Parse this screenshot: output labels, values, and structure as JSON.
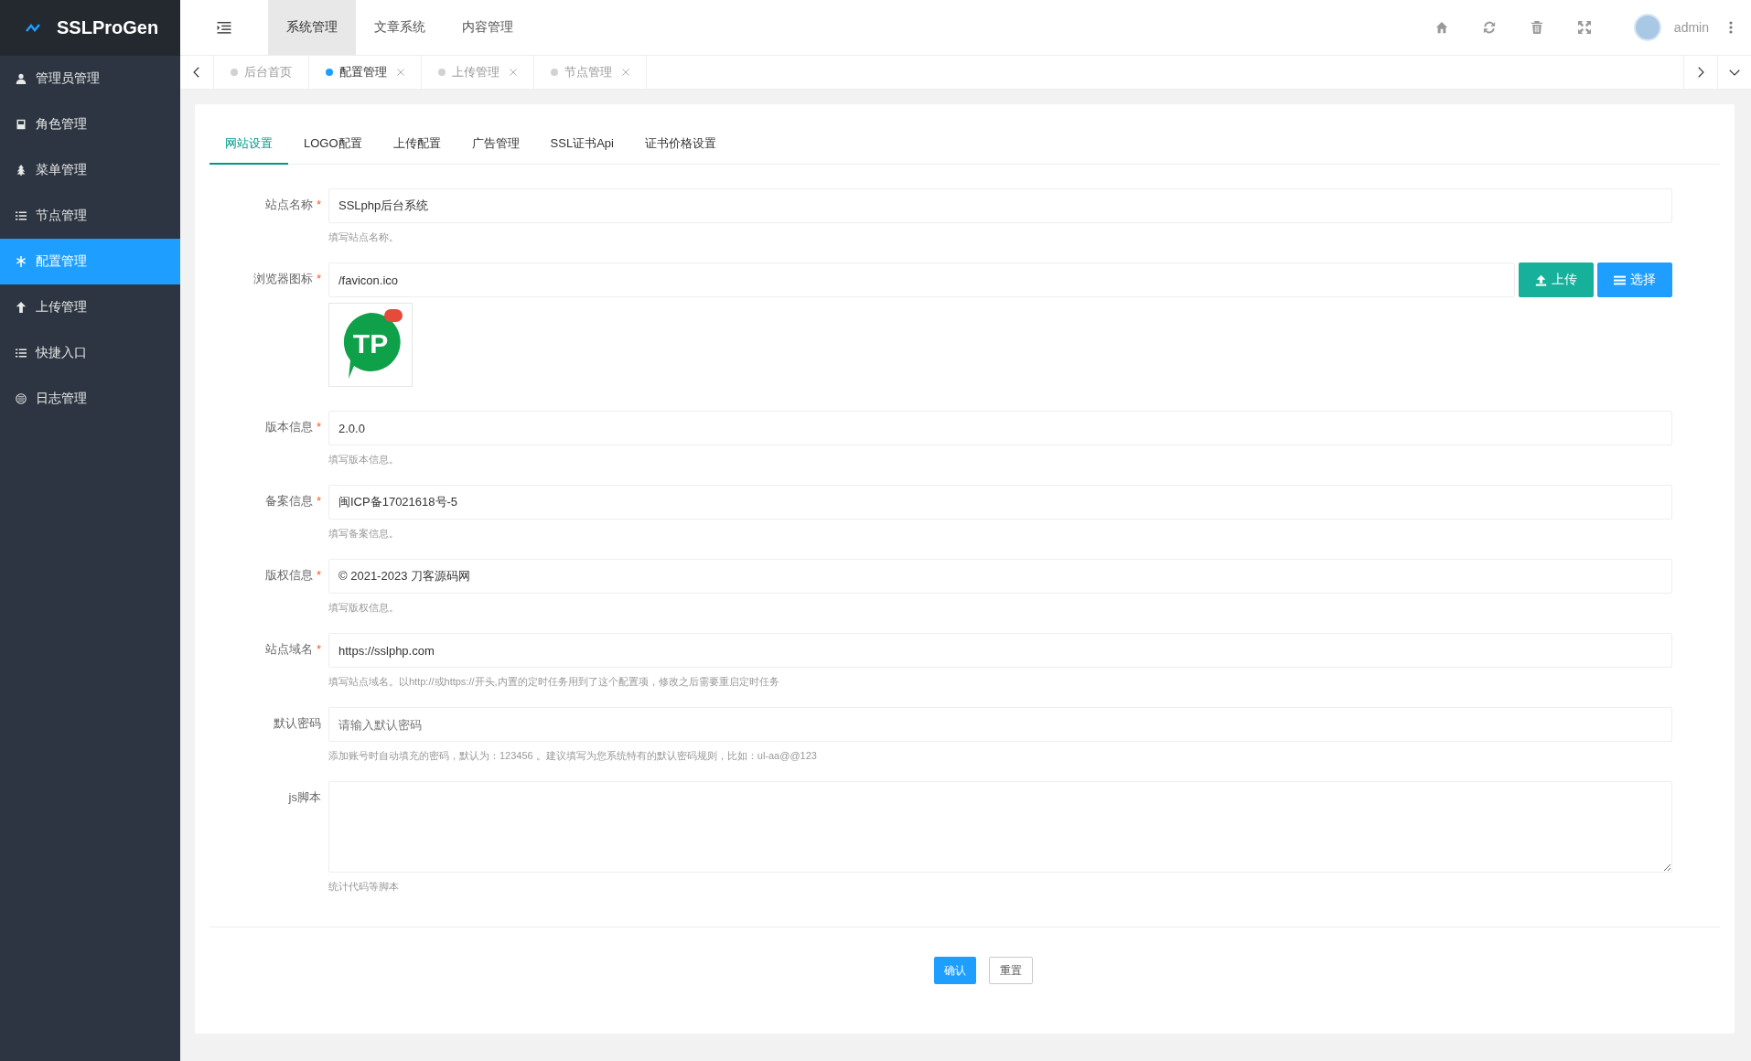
{
  "brand": {
    "title": "SSLProGen"
  },
  "top_nav": [
    {
      "label": "系统管理",
      "selected": true
    },
    {
      "label": "文章系统",
      "selected": false
    },
    {
      "label": "内容管理",
      "selected": false
    }
  ],
  "user": {
    "name": "admin"
  },
  "sidebar": {
    "items": [
      {
        "label": "管理员管理",
        "kind": "user",
        "selected": false
      },
      {
        "label": "角色管理",
        "kind": "badge",
        "selected": false
      },
      {
        "label": "菜单管理",
        "kind": "tree",
        "selected": false
      },
      {
        "label": "节点管理",
        "kind": "list",
        "selected": false
      },
      {
        "label": "配置管理",
        "kind": "gear",
        "selected": true
      },
      {
        "label": "上传管理",
        "kind": "up",
        "selected": false
      },
      {
        "label": "快捷入口",
        "kind": "list",
        "selected": false
      },
      {
        "label": "日志管理",
        "kind": "log",
        "selected": false
      }
    ]
  },
  "page_tabs": [
    {
      "label": "后台首页",
      "selected": false,
      "closable": false
    },
    {
      "label": "配置管理",
      "selected": true,
      "closable": true
    },
    {
      "label": "上传管理",
      "selected": false,
      "closable": true
    },
    {
      "label": "节点管理",
      "selected": false,
      "closable": true
    }
  ],
  "settings_tabs": [
    {
      "label": "网站设置",
      "selected": true
    },
    {
      "label": "LOGO配置",
      "selected": false
    },
    {
      "label": "上传配置",
      "selected": false
    },
    {
      "label": "广告管理",
      "selected": false
    },
    {
      "label": "SSL证书Api",
      "selected": false
    },
    {
      "label": "证书价格设置",
      "selected": false
    }
  ],
  "fields": [
    {
      "kind": "text",
      "label": "站点名称",
      "required_mark": "*",
      "value": "SSLphp后台系统",
      "hint": "填写站点名称。"
    },
    {
      "kind": "image",
      "label": "浏览器图标",
      "required_mark": "*",
      "value": "/favicon.ico",
      "upload_button": "上传",
      "choose_button": "选择",
      "preview_text": "TP"
    },
    {
      "kind": "text",
      "label": "版本信息",
      "required_mark": "*",
      "value": "2.0.0",
      "hint": "填写版本信息。"
    },
    {
      "kind": "text",
      "label": "备案信息",
      "required_mark": "*",
      "value": "闽ICP备17021618号-5",
      "hint": "填写备案信息。"
    },
    {
      "kind": "text",
      "label": "版权信息",
      "required_mark": "*",
      "value": "© 2021-2023 刀客源码网",
      "hint": "填写版权信息。"
    },
    {
      "kind": "text",
      "label": "站点域名",
      "required_mark": "*",
      "value": "https://sslphp.com",
      "hint": "填写站点域名。以http://或https://开头,内置的定时任务用到了这个配置项，修改之后需要重启定时任务"
    },
    {
      "kind": "text",
      "label": "默认密码",
      "placeholder": "请输入默认密码",
      "hint": "添加账号时自动填充的密码，默认为：123456 。建议填写为您系统特有的默认密码规则，比如：ul-aa@@123"
    },
    {
      "kind": "textarea",
      "label": "js脚本",
      "hint": "统计代码等脚本"
    }
  ],
  "actions": {
    "confirm": "确认",
    "reset": "重置"
  }
}
